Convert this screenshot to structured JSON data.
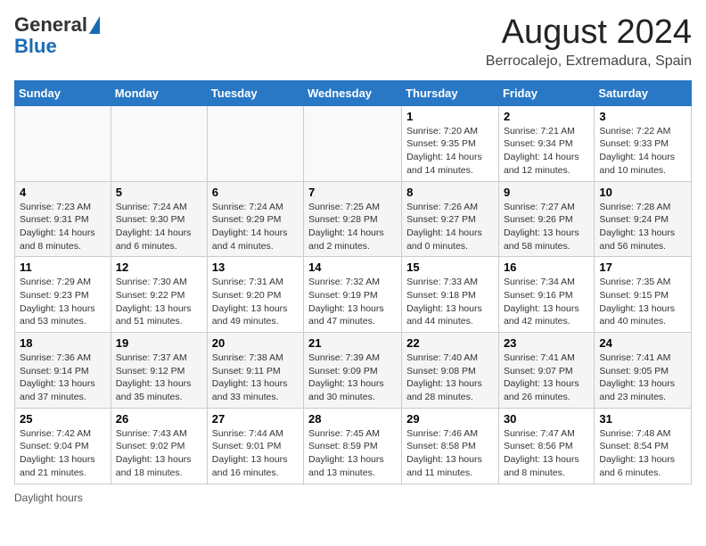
{
  "logo": {
    "line1": "General",
    "line2": "Blue"
  },
  "title": "August 2024",
  "subtitle": "Berrocalejo, Extremadura, Spain",
  "days_of_week": [
    "Sunday",
    "Monday",
    "Tuesday",
    "Wednesday",
    "Thursday",
    "Friday",
    "Saturday"
  ],
  "footer": "Daylight hours",
  "weeks": [
    [
      {
        "num": "",
        "info": ""
      },
      {
        "num": "",
        "info": ""
      },
      {
        "num": "",
        "info": ""
      },
      {
        "num": "",
        "info": ""
      },
      {
        "num": "1",
        "info": "Sunrise: 7:20 AM\nSunset: 9:35 PM\nDaylight: 14 hours\nand 14 minutes."
      },
      {
        "num": "2",
        "info": "Sunrise: 7:21 AM\nSunset: 9:34 PM\nDaylight: 14 hours\nand 12 minutes."
      },
      {
        "num": "3",
        "info": "Sunrise: 7:22 AM\nSunset: 9:33 PM\nDaylight: 14 hours\nand 10 minutes."
      }
    ],
    [
      {
        "num": "4",
        "info": "Sunrise: 7:23 AM\nSunset: 9:31 PM\nDaylight: 14 hours\nand 8 minutes."
      },
      {
        "num": "5",
        "info": "Sunrise: 7:24 AM\nSunset: 9:30 PM\nDaylight: 14 hours\nand 6 minutes."
      },
      {
        "num": "6",
        "info": "Sunrise: 7:24 AM\nSunset: 9:29 PM\nDaylight: 14 hours\nand 4 minutes."
      },
      {
        "num": "7",
        "info": "Sunrise: 7:25 AM\nSunset: 9:28 PM\nDaylight: 14 hours\nand 2 minutes."
      },
      {
        "num": "8",
        "info": "Sunrise: 7:26 AM\nSunset: 9:27 PM\nDaylight: 14 hours\nand 0 minutes."
      },
      {
        "num": "9",
        "info": "Sunrise: 7:27 AM\nSunset: 9:26 PM\nDaylight: 13 hours\nand 58 minutes."
      },
      {
        "num": "10",
        "info": "Sunrise: 7:28 AM\nSunset: 9:24 PM\nDaylight: 13 hours\nand 56 minutes."
      }
    ],
    [
      {
        "num": "11",
        "info": "Sunrise: 7:29 AM\nSunset: 9:23 PM\nDaylight: 13 hours\nand 53 minutes."
      },
      {
        "num": "12",
        "info": "Sunrise: 7:30 AM\nSunset: 9:22 PM\nDaylight: 13 hours\nand 51 minutes."
      },
      {
        "num": "13",
        "info": "Sunrise: 7:31 AM\nSunset: 9:20 PM\nDaylight: 13 hours\nand 49 minutes."
      },
      {
        "num": "14",
        "info": "Sunrise: 7:32 AM\nSunset: 9:19 PM\nDaylight: 13 hours\nand 47 minutes."
      },
      {
        "num": "15",
        "info": "Sunrise: 7:33 AM\nSunset: 9:18 PM\nDaylight: 13 hours\nand 44 minutes."
      },
      {
        "num": "16",
        "info": "Sunrise: 7:34 AM\nSunset: 9:16 PM\nDaylight: 13 hours\nand 42 minutes."
      },
      {
        "num": "17",
        "info": "Sunrise: 7:35 AM\nSunset: 9:15 PM\nDaylight: 13 hours\nand 40 minutes."
      }
    ],
    [
      {
        "num": "18",
        "info": "Sunrise: 7:36 AM\nSunset: 9:14 PM\nDaylight: 13 hours\nand 37 minutes."
      },
      {
        "num": "19",
        "info": "Sunrise: 7:37 AM\nSunset: 9:12 PM\nDaylight: 13 hours\nand 35 minutes."
      },
      {
        "num": "20",
        "info": "Sunrise: 7:38 AM\nSunset: 9:11 PM\nDaylight: 13 hours\nand 33 minutes."
      },
      {
        "num": "21",
        "info": "Sunrise: 7:39 AM\nSunset: 9:09 PM\nDaylight: 13 hours\nand 30 minutes."
      },
      {
        "num": "22",
        "info": "Sunrise: 7:40 AM\nSunset: 9:08 PM\nDaylight: 13 hours\nand 28 minutes."
      },
      {
        "num": "23",
        "info": "Sunrise: 7:41 AM\nSunset: 9:07 PM\nDaylight: 13 hours\nand 26 minutes."
      },
      {
        "num": "24",
        "info": "Sunrise: 7:41 AM\nSunset: 9:05 PM\nDaylight: 13 hours\nand 23 minutes."
      }
    ],
    [
      {
        "num": "25",
        "info": "Sunrise: 7:42 AM\nSunset: 9:04 PM\nDaylight: 13 hours\nand 21 minutes."
      },
      {
        "num": "26",
        "info": "Sunrise: 7:43 AM\nSunset: 9:02 PM\nDaylight: 13 hours\nand 18 minutes."
      },
      {
        "num": "27",
        "info": "Sunrise: 7:44 AM\nSunset: 9:01 PM\nDaylight: 13 hours\nand 16 minutes."
      },
      {
        "num": "28",
        "info": "Sunrise: 7:45 AM\nSunset: 8:59 PM\nDaylight: 13 hours\nand 13 minutes."
      },
      {
        "num": "29",
        "info": "Sunrise: 7:46 AM\nSunset: 8:58 PM\nDaylight: 13 hours\nand 11 minutes."
      },
      {
        "num": "30",
        "info": "Sunrise: 7:47 AM\nSunset: 8:56 PM\nDaylight: 13 hours\nand 8 minutes."
      },
      {
        "num": "31",
        "info": "Sunrise: 7:48 AM\nSunset: 8:54 PM\nDaylight: 13 hours\nand 6 minutes."
      }
    ]
  ]
}
